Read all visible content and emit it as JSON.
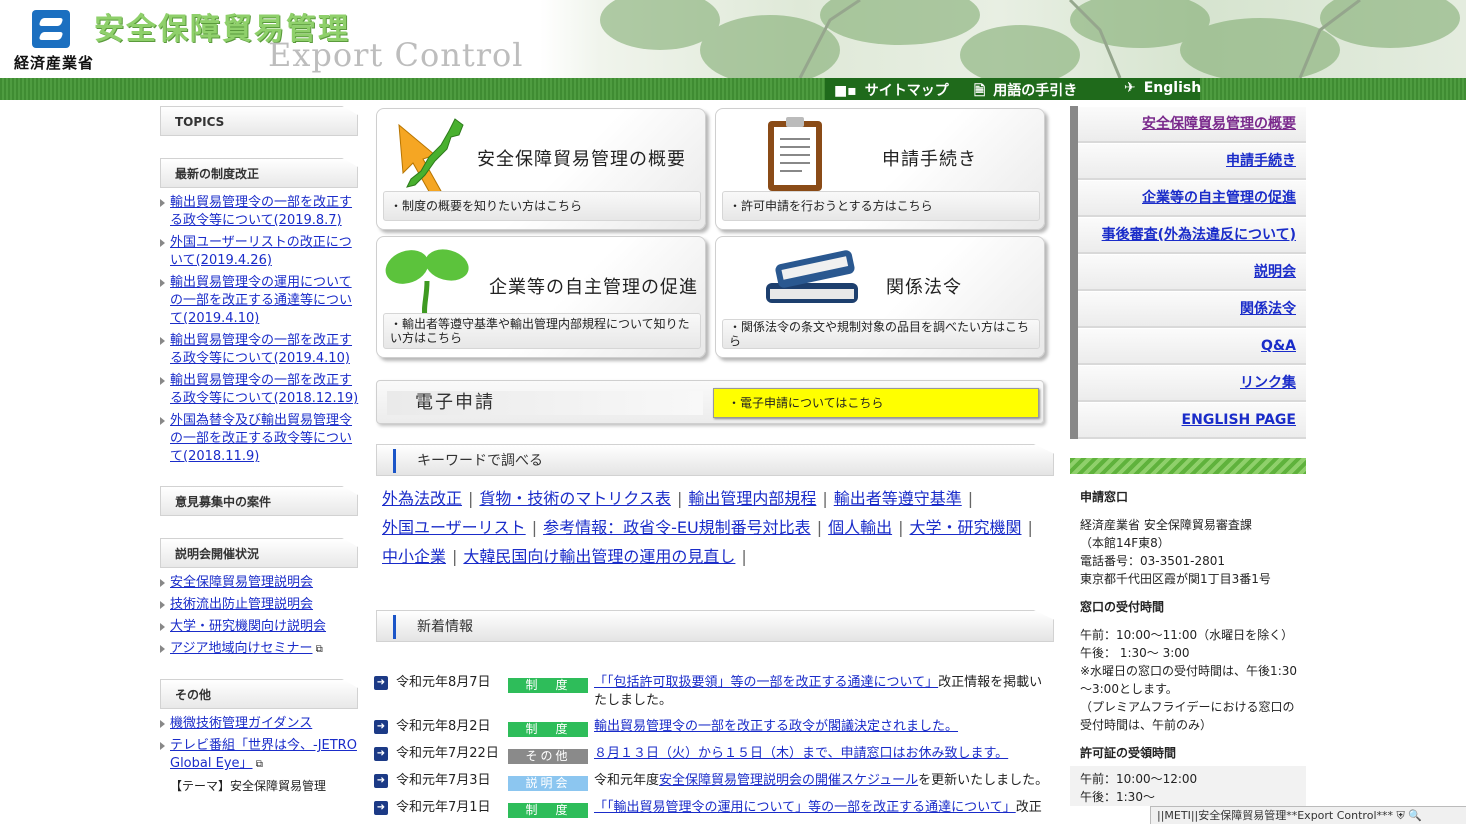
{
  "header": {
    "ministry": "経済産業省",
    "title": "安全保障貿易管理",
    "subtitle": "Export Control",
    "nav": [
      {
        "label": "サイトマップ",
        "icon": "sitemap-icon"
      },
      {
        "label": "用語の手引き",
        "icon": "document-icon"
      },
      {
        "label": "English",
        "icon": "plane-icon"
      }
    ]
  },
  "left": {
    "topics": "TOPICS",
    "latest_head": "最新の制度改正",
    "latest": [
      "輸出貿易管理令の一部を改正する政令等について(2019.8.7)",
      "外国ユーザーリストの改正について(2019.4.26)",
      "輸出貿易管理令の運用についての一部を改正する通達等について(2019.4.10)",
      "輸出貿易管理令の一部を改正する政令等について(2019.4.10)",
      "輸出貿易管理令の一部を改正する政令等について(2018.12.19)",
      "外国為替令及び輸出貿易管理令の一部を改正する政令等について(2018.11.9)"
    ],
    "opinion_head": "意見募集中の案件",
    "briefing_head": "説明会開催状況",
    "briefings": [
      "安全保障貿易管理説明会",
      "技術流出防止管理説明会",
      "大学・研究機関向け説明会",
      "アジア地域向けセミナー"
    ],
    "other_head": "その他",
    "others": [
      "機微技術管理ガイダンス",
      "テレビ番組「世界は今、-JETRO Global Eye」"
    ],
    "cut_item": "【テーマ】安全保障貿易管理"
  },
  "tiles": [
    {
      "title": "安全保障貿易管理の概要",
      "desc": "・制度の概要を知りたい方はこちら"
    },
    {
      "title": "申請手続き",
      "desc": "・許可申請を行おうとする方はこちら"
    },
    {
      "title": "企業等の自主管理の促進",
      "desc": "・輸出者等遵守基準や輸出管理内部規程について知りたい方はこちら"
    },
    {
      "title": "関係法令",
      "desc": "・関係法令の条文や規制対象の品目を調べたい方はこちら"
    }
  ],
  "electronic": {
    "label": "電子申請",
    "link": "・電子申請についてはこちら"
  },
  "keyword_head": "キーワードで調べる",
  "keywords": [
    "外為法改正",
    "貨物・技術のマトリクス表",
    "輸出管理内部規程",
    "輸出者等遵守基準",
    "外国ユーザーリスト",
    "参考情報：政省令-EU規制番号対比表",
    "個人輸出",
    "大学・研究機関",
    "中小企業",
    "大韓民国向け輸出管理の運用の見直し"
  ],
  "news_head": "新着情報",
  "news": [
    {
      "date": "令和元年8月7日",
      "badge": "制　度",
      "color": "#2ebd5a",
      "link": "「「包括許可取扱要領」等の一部を改正する通達について」",
      "tail": "改正情報を掲載いたしました。"
    },
    {
      "date": "令和元年8月2日",
      "badge": "制　度",
      "color": "#2ebd5a",
      "link": "輸出貿易管理令の一部を改正する政令が閣議決定されました。",
      "tail": ""
    },
    {
      "date": "令和元年7月22日",
      "badge": "その他",
      "color": "#8a8a8a",
      "link": "８月１３日（火）から１５日（木）まで、申請窓口はお休み致します。",
      "tail": ""
    },
    {
      "date": "令和元年7月3日",
      "badge": "説明会",
      "color": "#8cc6f0",
      "pre": "令和元年度",
      "link": "安全保障貿易管理説明会の開催スケジュール",
      "tail": "を更新いたしました。"
    },
    {
      "date": "令和元年7月1日",
      "badge": "制　度",
      "color": "#2ebd5a",
      "link": "「「輸出貿易管理令の運用について」等の一部を改正する通達について」",
      "tail": "改正"
    }
  ],
  "right_nav": [
    "安全保障貿易管理の概要",
    "申請手続き",
    "企業等の自主管理の促進",
    "事後審査(外為法違反について)",
    "説明会",
    "関係法令",
    "Q&A",
    "リンク集",
    "ENGLISH PAGE"
  ],
  "contact": {
    "head": "申請窓口",
    "lines": [
      "経済産業省 安全保障貿易審査課",
      "（本館14F東8）",
      "電話番号：03-3501-2801",
      "東京都千代田区霞が関1丁目3番1号"
    ],
    "hours_head": "窓口の受付時間",
    "hours": [
      "午前：10:00～11:00（水曜日を除く）",
      "午後：  1:30～  3:00",
      "※水曜日の窓口の受付時間は、午後1:30～3:00とします。",
      "（プレミアムフライデーにおける窓口の受付時間は、午前のみ）"
    ],
    "permit_head": "許可証の受領時間",
    "permit": [
      "午前：10:00～12:00",
      "午後：1:30～"
    ]
  },
  "statusbar": "||METI||安全保障貿易管理**Export Control***"
}
